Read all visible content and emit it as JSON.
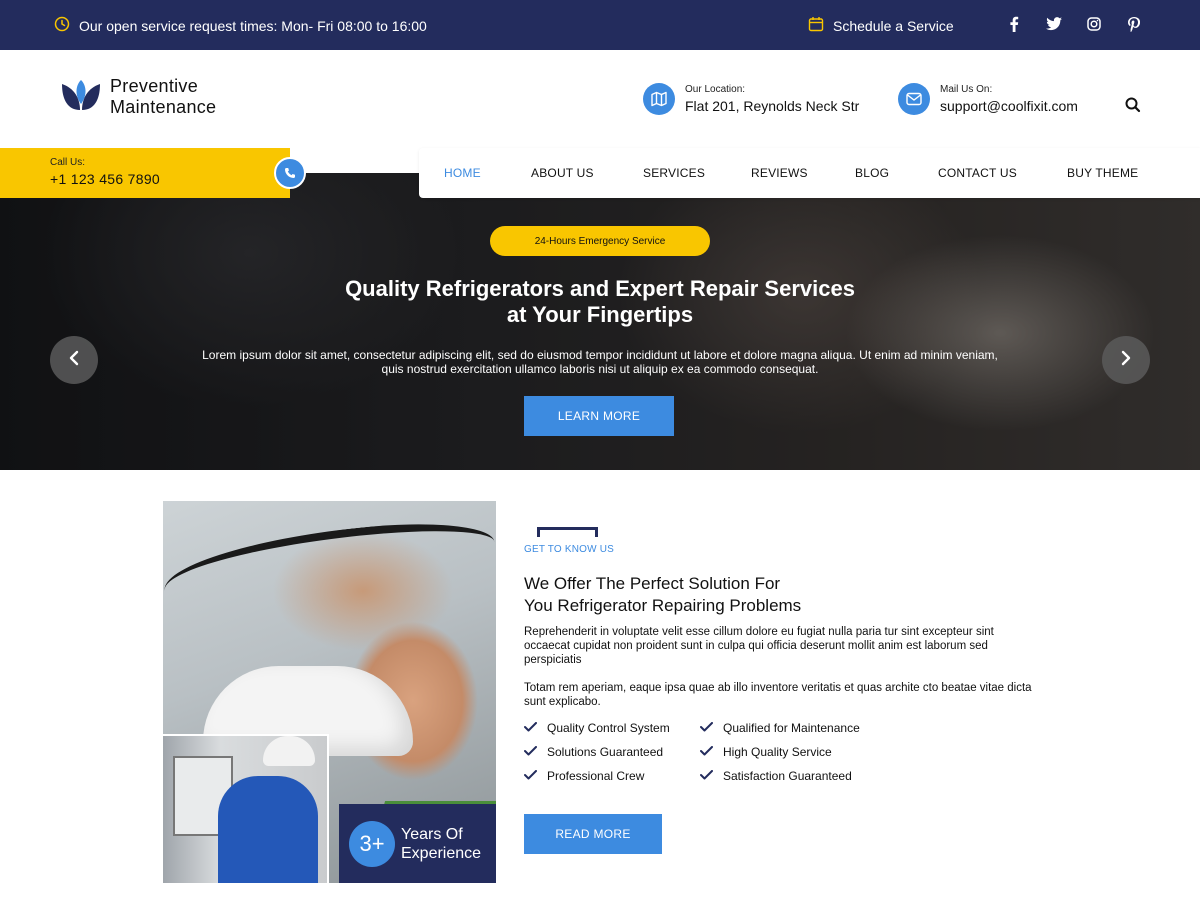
{
  "topbar": {
    "hours_text": "Our open service request times: Mon- Fri 08:00 to 16:00",
    "schedule_link": "Schedule a Service",
    "social": [
      "facebook-icon",
      "twitter-icon",
      "instagram-icon",
      "pinterest-icon"
    ]
  },
  "logo": {
    "line1": "Preventive",
    "line2": "Maintenance"
  },
  "header": {
    "location_label": "Our Location:",
    "location_value": "Flat 201, Reynolds Neck Str",
    "mail_label": "Mail Us On:",
    "mail_value": "support@coolfixit.com"
  },
  "call": {
    "label": "Call Us:",
    "number": "+1 123 456 7890"
  },
  "nav": {
    "items": [
      "HOME",
      "ABOUT US",
      "SERVICES",
      "REVIEWS",
      "BLOG",
      "CONTACT US",
      "BUY THEME"
    ],
    "active": "HOME"
  },
  "hero": {
    "badge": "24-Hours Emergency Service",
    "title_line1": "Quality Refrigerators and Expert Repair Services",
    "title_line2": "at Your Fingertips",
    "desc_line1": "Lorem ipsum dolor sit amet, consectetur adipiscing elit, sed do eiusmod tempor incididunt ut labore et dolore magna aliqua. Ut enim ad minim veniam,",
    "desc_line2": "quis nostrud exercitation ullamco laboris nisi ut aliquip ex ea commodo consequat.",
    "button": "LEARN MORE"
  },
  "about": {
    "kicker": "GET TO KNOW US",
    "title_line1": "We Offer The Perfect Solution For",
    "title_line2": "You Refrigerator Repairing Problems",
    "para1": "Reprehenderit in voluptate velit esse cillum dolore eu fugiat nulla paria tur sint excepteur sint occaecat cupidat non proident sunt in culpa qui officia deserunt mollit anim est laborum sed perspiciatis",
    "para2": "Totam rem aperiam, eaque ipsa quae ab illo inventore veritatis et quas archite cto beatae vitae dicta sunt explicabo.",
    "features_left": [
      "Quality Control System",
      "Solutions Guaranteed",
      "Professional Crew"
    ],
    "features_right": [
      "Qualified for Maintenance",
      "High Quality Service",
      "Satisfaction Guaranteed"
    ],
    "button": "READ MORE",
    "experience_number": "3+",
    "experience_line1": "Years Of",
    "experience_line2": "Experience"
  },
  "colors": {
    "navy": "#232c5d",
    "accent_blue": "#3d8be0",
    "accent_yellow": "#f9c600"
  }
}
